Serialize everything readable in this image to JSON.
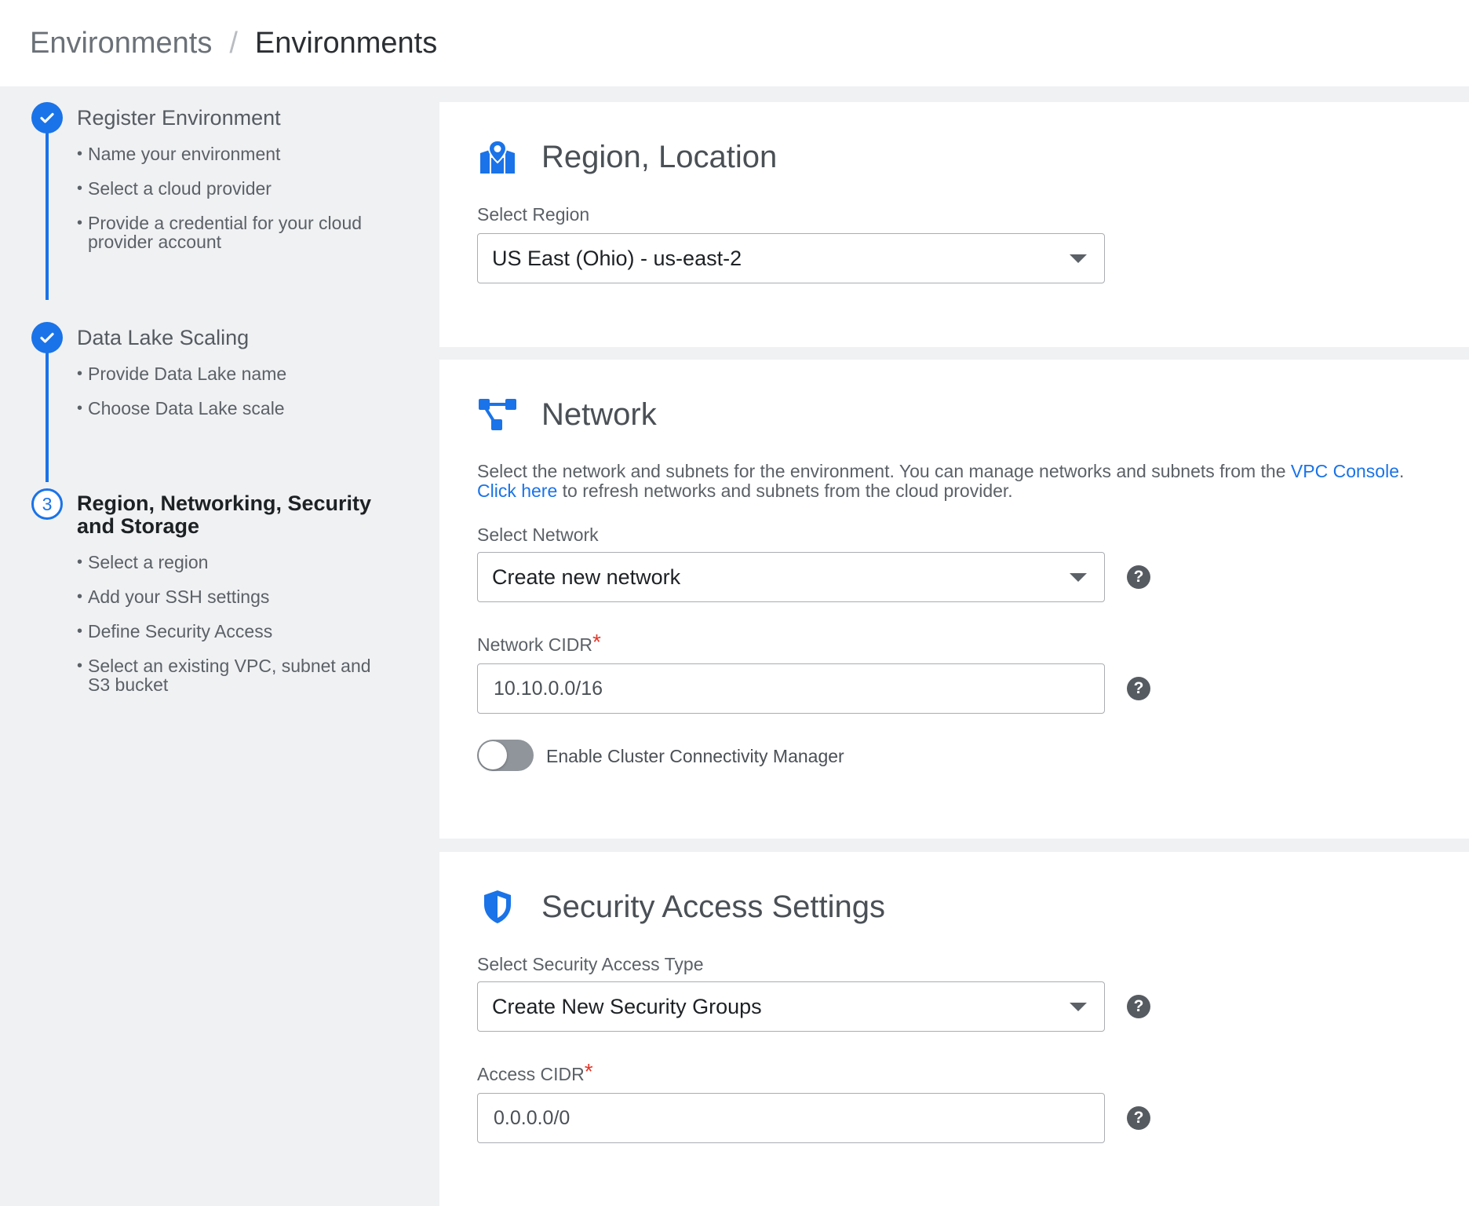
{
  "breadcrumb": {
    "first": "Environments",
    "separator": "/",
    "current": "Environments"
  },
  "wizard": {
    "steps": [
      {
        "title": "Register Environment",
        "status": "completed",
        "items": [
          "Name your environment",
          "Select a cloud provider",
          "Provide a credential for your cloud provider account"
        ]
      },
      {
        "title": "Data Lake Scaling",
        "status": "completed",
        "items": [
          "Provide Data Lake name",
          "Choose Data Lake scale"
        ]
      },
      {
        "title": "Region, Networking, Security and Storage",
        "status": "current",
        "number": "3",
        "items": [
          "Select a region",
          "Add your SSH settings",
          "Define Security Access",
          "Select an existing VPC, subnet and S3 bucket"
        ]
      }
    ]
  },
  "region": {
    "title": "Region, Location",
    "icon": "map-pin-icon",
    "label": "Select Region",
    "value": "US East (Ohio) - us-east-2"
  },
  "network": {
    "title": "Network",
    "icon": "network-icon",
    "desc_text_1": "Select the network and subnets for the environment. You can manage networks and subnets from the ",
    "desc_link_1": "VPC Console",
    "desc_text_2": ".",
    "desc_link_2": "Click here",
    "desc_text_3": " to refresh networks and subnets from the cloud provider.",
    "select_label": "Select Network",
    "select_value": "Create new network",
    "cidr_label": "Network CIDR",
    "cidr_required": "*",
    "cidr_value": "10.10.0.0/16",
    "ccm_label": "Enable Cluster Connectivity Manager",
    "ccm_enabled": false
  },
  "security": {
    "title": "Security Access Settings",
    "icon": "shield-icon",
    "select_label": "Select Security Access Type",
    "select_value": "Create New Security Groups",
    "cidr_label": "Access CIDR",
    "cidr_required": "*",
    "cidr_value": "0.0.0.0/0"
  },
  "help_glyph": "?",
  "colors": {
    "accent": "#1a73e8",
    "required": "#e2382a",
    "background": "#f0f1f3"
  }
}
